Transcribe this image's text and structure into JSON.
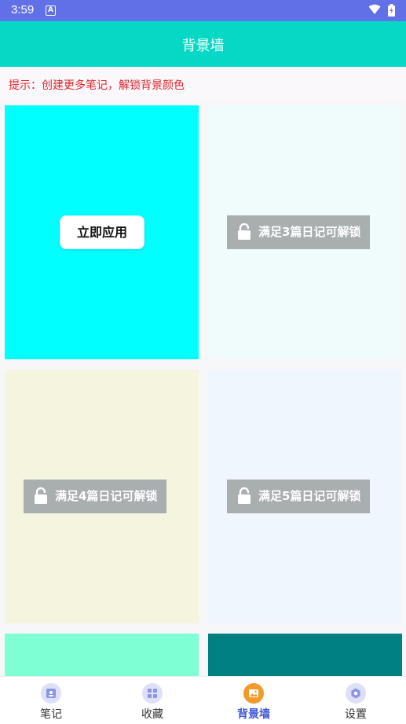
{
  "status_bar": {
    "time": "3:59"
  },
  "app_bar": {
    "title": "背景墙"
  },
  "tip": {
    "text": "提示：创建更多笔记，解锁背景颜色"
  },
  "colors": {
    "status_bar": "#6270e8",
    "app_bar": "#05d9c6",
    "tip_text": "#e0242b",
    "nav_active": "#3c55d6",
    "nav_active_icon": "#f39a2a"
  },
  "backgrounds": [
    {
      "color": "#00ffff",
      "state": "unlocked",
      "label": "立即应用"
    },
    {
      "color": "#f0fcfc",
      "state": "locked",
      "label": "满足3篇日记可解锁"
    },
    {
      "color": "#f5f5df",
      "state": "locked",
      "label": "满足4篇日记可解锁"
    },
    {
      "color": "#f0f6fe",
      "state": "locked",
      "label": "满足5篇日记可解锁"
    },
    {
      "color": "#7fffd4",
      "state": "partial"
    },
    {
      "color": "#008080",
      "state": "partial"
    }
  ],
  "bottom_nav": {
    "items": [
      {
        "label": "笔记",
        "icon": "notes-icon"
      },
      {
        "label": "收藏",
        "icon": "favorites-icon"
      },
      {
        "label": "背景墙",
        "icon": "background-wall-icon",
        "active": true
      },
      {
        "label": "设置",
        "icon": "settings-icon"
      }
    ]
  }
}
